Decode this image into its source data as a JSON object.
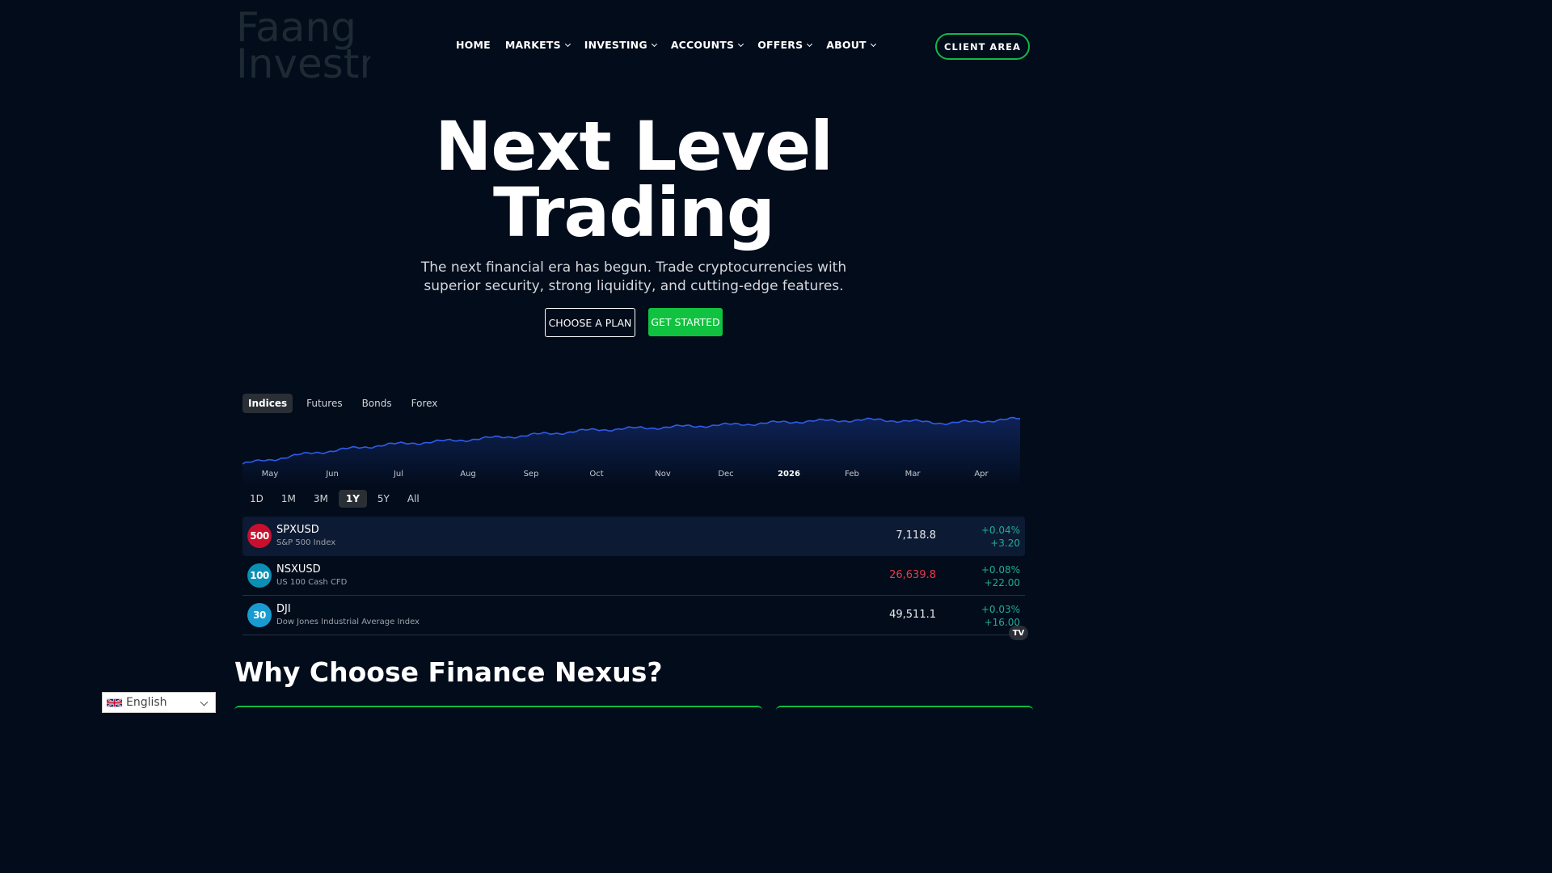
{
  "header": {
    "logo_lines": [
      "Faang",
      "Investm"
    ],
    "nav": [
      {
        "label": "HOME",
        "dropdown": false
      },
      {
        "label": "MARKETS",
        "dropdown": true
      },
      {
        "label": "INVESTING",
        "dropdown": true
      },
      {
        "label": "ACCOUNTS",
        "dropdown": true
      },
      {
        "label": "OFFERS",
        "dropdown": true
      },
      {
        "label": "ABOUT",
        "dropdown": true
      }
    ],
    "client_area": "CLIENT AREA"
  },
  "hero": {
    "title_line1": "Next Level",
    "title_line2": "Trading",
    "subtitle_line1": "The next financial era has begun. Trade cryptocurrencies with",
    "subtitle_line2": "superior security, strong liquidity, and cutting-edge features.",
    "choose_plan": "CHOOSE A PLAN",
    "get_started": "GET STARTED"
  },
  "widget": {
    "tabs": [
      "Indices",
      "Futures",
      "Bonds",
      "Forex"
    ],
    "active_tab": "Indices",
    "months": [
      "May",
      "Jun",
      "Jul",
      "Aug",
      "Sep",
      "Oct",
      "Nov",
      "Dec",
      "2026",
      "Feb",
      "Mar",
      "Apr"
    ],
    "ranges": [
      "1D",
      "1M",
      "3M",
      "1Y",
      "5Y",
      "All"
    ],
    "active_range": "1Y",
    "rows": [
      {
        "badge": "500",
        "badge_color": "#c8102e",
        "symbol": "SPXUSD",
        "description": "S&P 500 Index",
        "price": "7,118.8",
        "price_trend": "neutral",
        "change_pct": "+0.04%",
        "change_abs": "+3.20"
      },
      {
        "badge": "100",
        "badge_color": "#0b8fb5",
        "symbol": "NSXUSD",
        "description": "US 100 Cash CFD",
        "price": "26,639.8",
        "price_trend": "down",
        "change_pct": "+0.08%",
        "change_abs": "+22.00"
      },
      {
        "badge": "30",
        "badge_color": "#1a9bd0",
        "symbol": "DJI",
        "description": "Dow Jones Industrial Average Index",
        "price": "49,511.1",
        "price_trend": "neutral",
        "change_pct": "+0.03%",
        "change_abs": "+16.00"
      }
    ],
    "tv_logo": "TV"
  },
  "section": {
    "title": "Why Choose Finance Nexus?"
  },
  "language": {
    "selected": "English"
  },
  "colors": {
    "accent": "#10c23f",
    "chart_line": "#2f5bea",
    "background": "#020c1b"
  },
  "chart_data": {
    "type": "area",
    "x": [
      "May",
      "Jun",
      "Jul",
      "Aug",
      "Sep",
      "Oct",
      "Nov",
      "Dec",
      "2026",
      "Feb",
      "Mar",
      "Apr"
    ],
    "series": [
      {
        "values": [
          5600,
          5930,
          6170,
          6300,
          6450,
          6620,
          6700,
          6780,
          6880,
          6920,
          6820,
          6950
        ]
      }
    ]
  }
}
